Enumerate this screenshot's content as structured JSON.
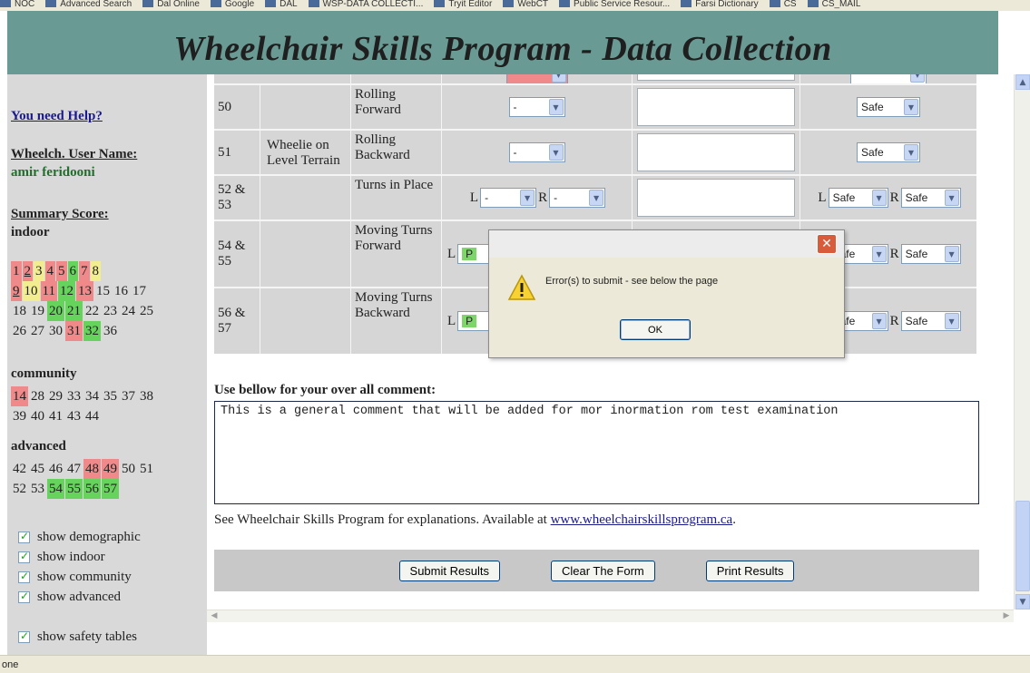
{
  "bookmarks": [
    "NOC",
    "Advanced Search",
    "Dal Online",
    "Google",
    "DAL",
    "WSP-DATA COLLECTI...",
    "Tryit Editor",
    "WebCT",
    "Public Service Resour...",
    "Farsi Dictionary",
    "CS",
    "CS_MAIL"
  ],
  "banner": {
    "title": "Wheelchair Skills Program - Data Collection"
  },
  "sidebar": {
    "help_link": "You need Help?",
    "user_label": "Wheelch. User Name:",
    "user_value": "amir  feridooni",
    "summary_label": "Summary Score:",
    "indoor_label": "indoor",
    "indoor_scores": [
      [
        {
          "n": "1",
          "c": "red"
        },
        {
          "n": "2",
          "c": "red",
          "u": true
        },
        {
          "n": "3",
          "c": "yellow"
        },
        {
          "n": "4",
          "c": "red"
        },
        {
          "n": "5",
          "c": "red"
        },
        {
          "n": "6",
          "c": "green"
        },
        {
          "n": "7",
          "c": "red"
        },
        {
          "n": "8",
          "c": "yellow"
        }
      ],
      [
        {
          "n": "9",
          "c": "red",
          "u": true
        },
        {
          "n": "10",
          "c": "yellow"
        },
        {
          "n": "11",
          "c": "red"
        },
        {
          "n": "12",
          "c": "green"
        },
        {
          "n": "13",
          "c": "red"
        },
        {
          "n": "15",
          "c": ""
        },
        {
          "n": "16",
          "c": ""
        },
        {
          "n": "17",
          "c": ""
        }
      ],
      [
        {
          "n": "18",
          "c": ""
        },
        {
          "n": "19",
          "c": ""
        },
        {
          "n": "20",
          "c": "green"
        },
        {
          "n": "21",
          "c": "green"
        },
        {
          "n": "22",
          "c": ""
        },
        {
          "n": "23",
          "c": ""
        },
        {
          "n": "24",
          "c": ""
        },
        {
          "n": "25",
          "c": ""
        }
      ],
      [
        {
          "n": "26",
          "c": ""
        },
        {
          "n": "27",
          "c": ""
        },
        {
          "n": "30",
          "c": ""
        },
        {
          "n": "31",
          "c": "red"
        },
        {
          "n": "32",
          "c": "green"
        },
        {
          "n": "36",
          "c": ""
        }
      ]
    ],
    "community_label": "community",
    "community_scores": [
      [
        {
          "n": "14",
          "c": "red"
        },
        {
          "n": "28",
          "c": ""
        },
        {
          "n": "29",
          "c": ""
        },
        {
          "n": "33",
          "c": ""
        },
        {
          "n": "34",
          "c": ""
        },
        {
          "n": "35",
          "c": ""
        },
        {
          "n": "37",
          "c": ""
        },
        {
          "n": "38",
          "c": ""
        }
      ],
      [
        {
          "n": "39",
          "c": ""
        },
        {
          "n": "40",
          "c": ""
        },
        {
          "n": "41",
          "c": ""
        },
        {
          "n": "43",
          "c": ""
        },
        {
          "n": "44",
          "c": ""
        }
      ]
    ],
    "advanced_label": "advanced",
    "advanced_scores": [
      [
        {
          "n": "42",
          "c": ""
        },
        {
          "n": "45",
          "c": ""
        },
        {
          "n": "46",
          "c": ""
        },
        {
          "n": "47",
          "c": ""
        },
        {
          "n": "48",
          "c": "red"
        },
        {
          "n": "49",
          "c": "red"
        },
        {
          "n": "50",
          "c": ""
        },
        {
          "n": "51",
          "c": ""
        }
      ],
      [
        {
          "n": "52",
          "c": ""
        },
        {
          "n": "53",
          "c": ""
        },
        {
          "n": "54",
          "c": "green"
        },
        {
          "n": "55",
          "c": "green"
        },
        {
          "n": "56",
          "c": "green"
        },
        {
          "n": "57",
          "c": "green"
        }
      ]
    ],
    "checkboxes": [
      "show demographic",
      "show indoor",
      "show community",
      "show advanced",
      "show safety tables"
    ]
  },
  "table": {
    "group_label": "Wheelie on Level Terrain",
    "rows": [
      {
        "num": "50",
        "name": "Rolling Forward",
        "left_sel": "-",
        "safety": "Safe"
      },
      {
        "num": "51",
        "name": "Rolling Backward",
        "left_sel": "-",
        "safety": "Safe"
      },
      {
        "num": "52 & 53",
        "name": "Turns in Place",
        "left_sel": "-",
        "right_sel": "-",
        "safety": "Safe",
        "safety_r": "Safe"
      },
      {
        "num": "54 & 55",
        "name": "Moving Turns Forward",
        "left_sel": "P",
        "safety": "Safe",
        "safety_r": "Safe"
      },
      {
        "num": "56 & 57",
        "name": "Moving Turns Backward",
        "left_sel": "P",
        "safety": "Safe",
        "safety_r": "Safe"
      }
    ],
    "l_label": "L",
    "r_label": "R"
  },
  "comment": {
    "label": "Use bellow for your over all comment:",
    "value": "This is a general comment that will be added for mor inormation rom test examination"
  },
  "see_text": {
    "prefix": "See Wheelchair Skills Program for explanations. Available at ",
    "link": "www.wheelchairskillsprogram.ca",
    "suffix": "."
  },
  "buttons": {
    "submit": "Submit Results",
    "clear": "Clear The Form",
    "print": "Print Results"
  },
  "dialog": {
    "message": "Error(s) to submit - see below the page",
    "ok": "OK"
  },
  "status": {
    "text": "one"
  },
  "colors": {
    "banner": "#6a9a94",
    "red": "#f08a8a",
    "green": "#66d45c",
    "yellow": "#f2ee90"
  }
}
